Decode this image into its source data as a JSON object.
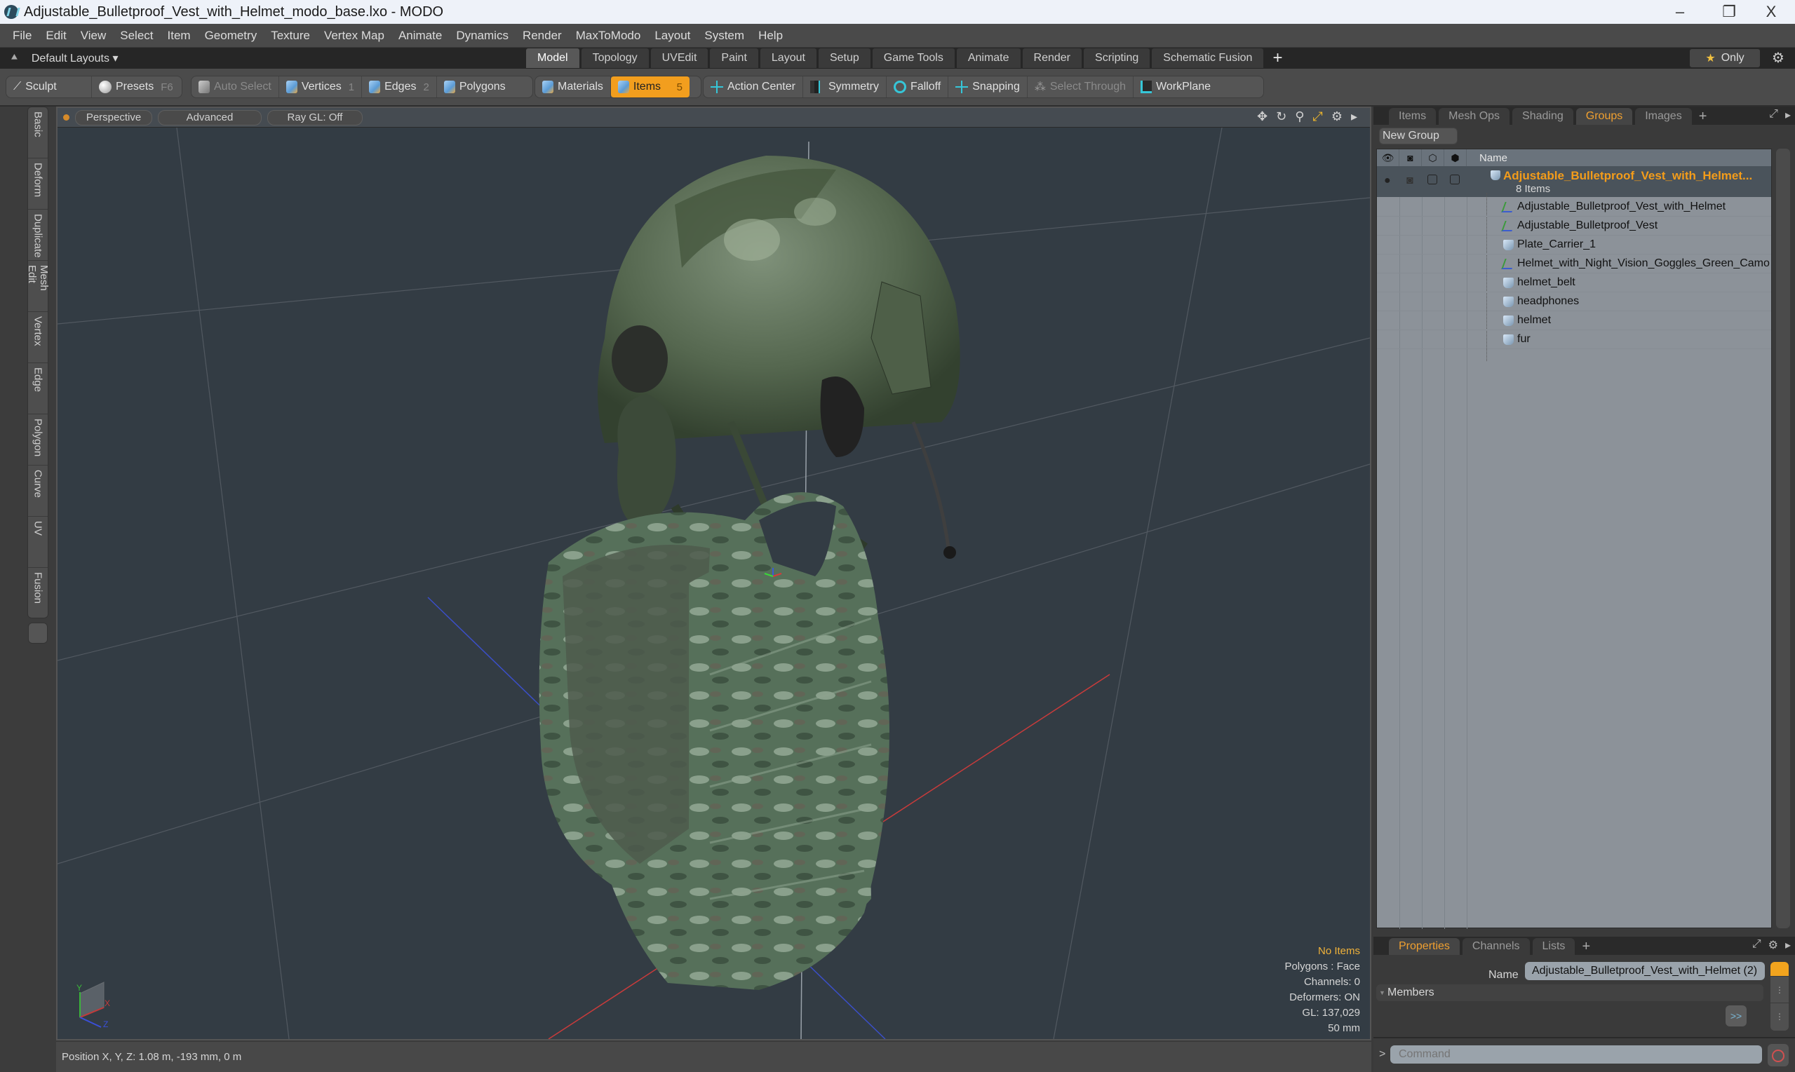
{
  "window": {
    "title": "Adjustable_Bulletproof_Vest_with_Helmet_modo_base.lxo - MODO",
    "controls": {
      "minimize": "–",
      "restore": "❐",
      "close": "X"
    }
  },
  "menubar": [
    "File",
    "Edit",
    "View",
    "Select",
    "Item",
    "Geometry",
    "Texture",
    "Vertex Map",
    "Animate",
    "Dynamics",
    "Render",
    "MaxToModo",
    "Layout",
    "System",
    "Help"
  ],
  "layout_row": {
    "layouts_label": "Default Layouts ▾",
    "tabs": [
      "Model",
      "Topology",
      "UVEdit",
      "Paint",
      "Layout",
      "Setup",
      "Game Tools",
      "Animate",
      "Render",
      "Scripting",
      "Schematic Fusion"
    ],
    "active_tab": "Model",
    "add_tab": "+",
    "only_label": "Only"
  },
  "toolbar": {
    "sculpt": "Sculpt",
    "presets": "Presets",
    "presets_key": "F6",
    "auto_select": "Auto Select",
    "vertices": "Vertices",
    "vertices_count": "1",
    "edges": "Edges",
    "edges_count": "2",
    "polygons": "Polygons",
    "materials": "Materials",
    "items": "Items",
    "items_count": "5",
    "action_center": "Action Center",
    "symmetry": "Symmetry",
    "falloff": "Falloff",
    "snapping": "Snapping",
    "select_through": "Select Through",
    "workplane": "WorkPlane"
  },
  "left_tabs": [
    "Basic",
    "Deform",
    "Duplicate",
    "Mesh Edit",
    "Vertex",
    "Edge",
    "Polygon",
    "Curve",
    "UV",
    "Fusion"
  ],
  "viewport": {
    "view_mode": "Perspective",
    "shading": "Advanced",
    "raygl": "Ray GL: Off",
    "info": {
      "selection": "No Items",
      "polygons": "Polygons : Face",
      "channels": "Channels: 0",
      "deformers": "Deformers: ON",
      "gl": "GL: 137,029",
      "scale": "50 mm"
    },
    "gizmo": {
      "x": "X",
      "y": "Y",
      "z": "Z"
    }
  },
  "statusbar": {
    "position": "Position X, Y, Z:   1.08 m, -193 mm, 0 m"
  },
  "groups_panel": {
    "tabs": [
      "Items",
      "Mesh Ops",
      "Shading",
      "Groups",
      "Images"
    ],
    "active_tab": "Groups",
    "new_group": "New Group",
    "column_name": "Name",
    "group": {
      "name": "Adjustable_Bulletproof_Vest_with_Helmet...",
      "count": "8 Items"
    },
    "items": [
      {
        "name": "Adjustable_Bulletproof_Vest_with_Helmet",
        "type": "locator"
      },
      {
        "name": "Adjustable_Bulletproof_Vest",
        "type": "locator"
      },
      {
        "name": "Plate_Carrier_1",
        "type": "mesh"
      },
      {
        "name": "Helmet_with_Night_Vision_Goggles_Green_Camo",
        "type": "locator"
      },
      {
        "name": "helmet_belt",
        "type": "mesh"
      },
      {
        "name": "headphones",
        "type": "mesh"
      },
      {
        "name": "helmet",
        "type": "mesh"
      },
      {
        "name": "fur",
        "type": "mesh"
      }
    ]
  },
  "properties_panel": {
    "tabs": [
      "Properties",
      "Channels",
      "Lists"
    ],
    "active_tab": "Properties",
    "name_label": "Name",
    "name_value": "Adjustable_Bulletproof_Vest_with_Helmet (2)",
    "members_label": "Members",
    "forward": ">>"
  },
  "command": {
    "prompt": ">",
    "placeholder": "Command"
  },
  "colors": {
    "accent": "#f29e1e",
    "group_name": "#f39c1a",
    "viewport_bg": "#333c44"
  }
}
